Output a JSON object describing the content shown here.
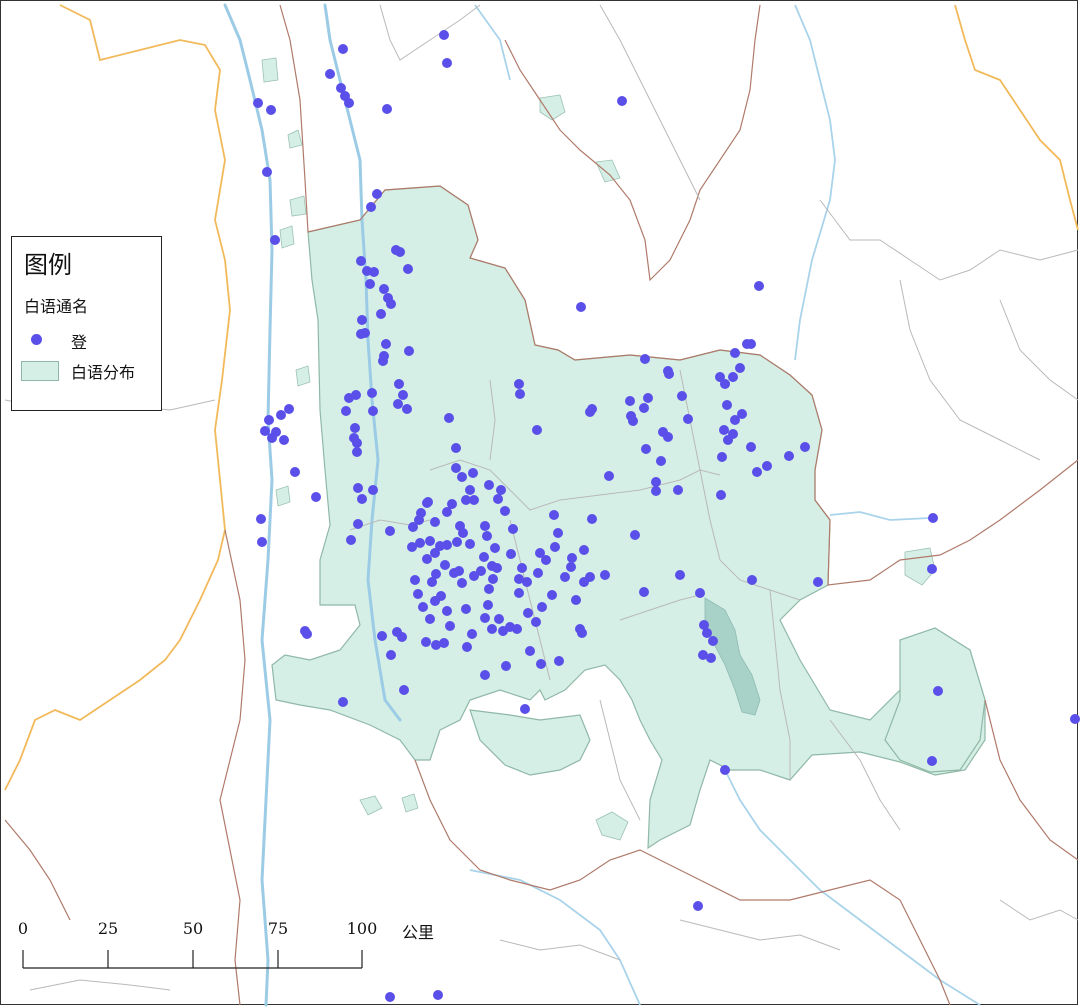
{
  "legend": {
    "title": "图例",
    "subtitle": "白语通名",
    "point_label": "登",
    "area_label": "白语分布"
  },
  "scale": {
    "ticks": [
      "0",
      "25",
      "50",
      "75",
      "100"
    ],
    "unit": "公里"
  },
  "colors": {
    "point": "#5a4fe8",
    "bai_area": "#d5efe6",
    "river": "#9ccbe6",
    "province_border": "#f2b95a",
    "prefecture_border": "#b07a6a",
    "county_border": "#b9b9b9"
  }
}
